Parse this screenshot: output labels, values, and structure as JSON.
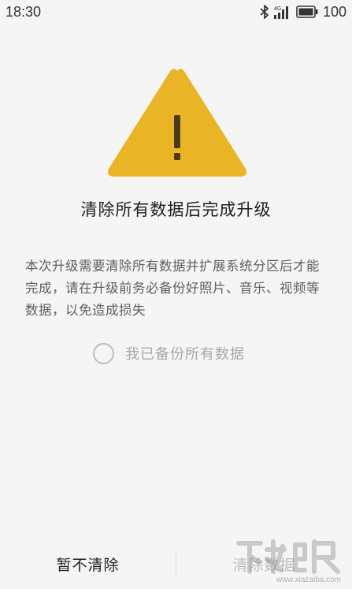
{
  "status_bar": {
    "time": "18:30",
    "network_label": "4G",
    "battery_level": "100"
  },
  "warning_icon": "warning-triangle-icon",
  "title": "清除所有数据后完成升级",
  "description": "本次升级需要清除所有数据并扩展系统分区后才能完成，请在升级前务必备份好照片、音乐、视频等数据，以免造成损失",
  "confirm": {
    "label": "我已备份所有数据",
    "checked": false
  },
  "buttons": {
    "cancel_label": "暂不清除",
    "clear_label": "清除数据",
    "clear_enabled": false
  },
  "watermark": {
    "text": "www.xiazaiba.com"
  },
  "colors": {
    "warning": "#e9b526",
    "background": "#f5f5f5",
    "disabled_text": "#bdbdbd"
  }
}
